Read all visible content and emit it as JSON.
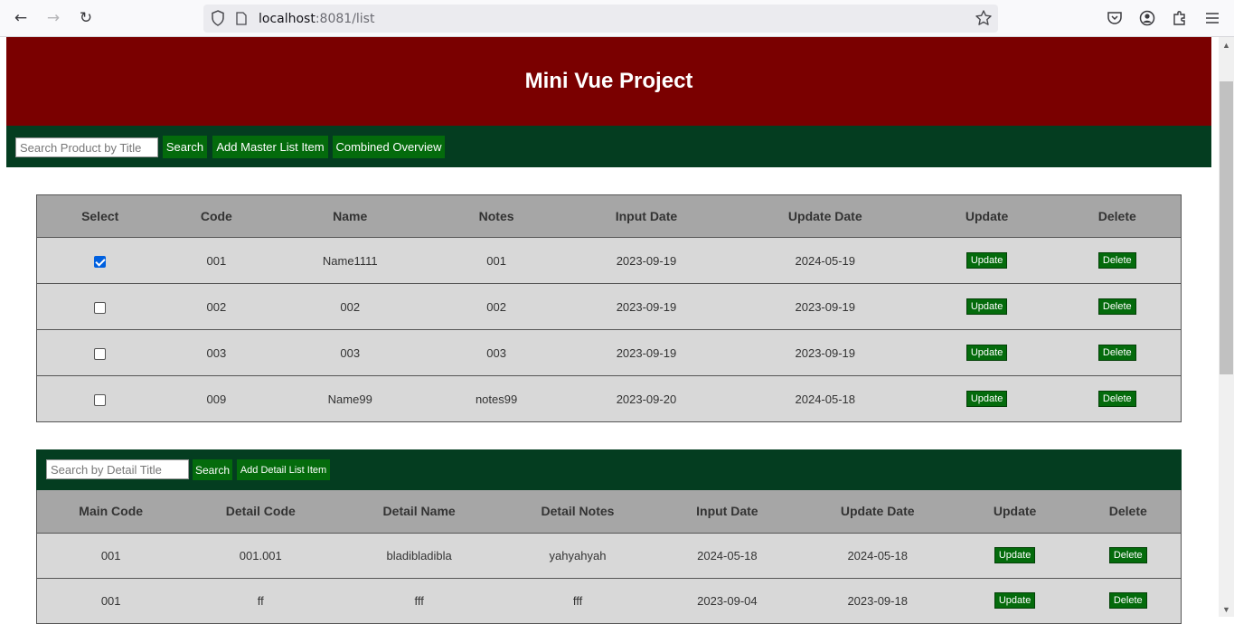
{
  "browser": {
    "url_host": "localhost",
    "url_rest": ":8081/list"
  },
  "page": {
    "title": "Mini Vue Project"
  },
  "master_toolbar": {
    "search_placeholder": "Search Product by Title",
    "search_label": "Search",
    "add_label": "Add Master List Item",
    "overview_label": "Combined Overview"
  },
  "master_table": {
    "headers": [
      "Select",
      "Code",
      "Name",
      "Notes",
      "Input Date",
      "Update Date",
      "Update",
      "Delete"
    ],
    "rows": [
      {
        "selected": true,
        "code": "001",
        "name": "Name1111",
        "notes": "001",
        "input_date": "2023-09-19",
        "update_date": "2024-05-19"
      },
      {
        "selected": false,
        "code": "002",
        "name": "002",
        "notes": "002",
        "input_date": "2023-09-19",
        "update_date": "2023-09-19"
      },
      {
        "selected": false,
        "code": "003",
        "name": "003",
        "notes": "003",
        "input_date": "2023-09-19",
        "update_date": "2023-09-19"
      },
      {
        "selected": false,
        "code": "009",
        "name": "Name99",
        "notes": "notes99",
        "input_date": "2023-09-20",
        "update_date": "2024-05-18"
      }
    ],
    "update_label": "Update",
    "delete_label": "Delete"
  },
  "detail_toolbar": {
    "search_placeholder": "Search by Detail Title",
    "search_label": "Search",
    "add_label": "Add Detail List Item"
  },
  "detail_table": {
    "headers": [
      "Main Code",
      "Detail Code",
      "Detail Name",
      "Detail Notes",
      "Input Date",
      "Update Date",
      "Update",
      "Delete"
    ],
    "rows": [
      {
        "main_code": "001",
        "detail_code": "001.001",
        "detail_name": "bladibladibla",
        "detail_notes": "yahyahyah",
        "input_date": "2024-05-18",
        "update_date": "2024-05-18"
      },
      {
        "main_code": "001",
        "detail_code": "ff",
        "detail_name": "fff",
        "detail_notes": "fff",
        "input_date": "2023-09-04",
        "update_date": "2023-09-18"
      }
    ],
    "update_label": "Update",
    "delete_label": "Delete"
  },
  "colors": {
    "header_bg": "#7a0000",
    "toolbar_bg": "#043d20",
    "button_bg": "#046b0c",
    "table_header_bg": "#a6a6a6",
    "table_row_bg": "#d8d8d8"
  }
}
